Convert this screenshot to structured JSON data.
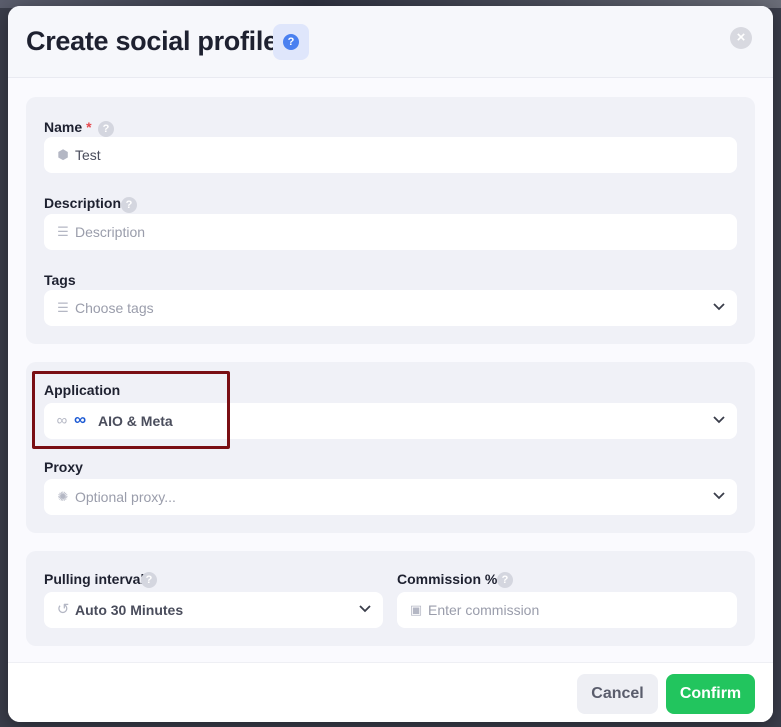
{
  "dialog": {
    "title": "Create social profile",
    "help_icon": "question-icon",
    "close_icon": "close-icon"
  },
  "details": {
    "name": {
      "label": "Name",
      "required_mark": "*",
      "value": "Test",
      "icon": "hexagon-icon"
    },
    "description": {
      "label": "Description",
      "placeholder": "Description",
      "icon": "rows-icon"
    },
    "tags": {
      "label": "Tags",
      "placeholder": "Choose tags",
      "icon": "rows-icon"
    }
  },
  "connection": {
    "application": {
      "label": "Application",
      "value": "AIO & Meta",
      "icons": [
        "infinity-icon",
        "meta-icon"
      ]
    },
    "proxy": {
      "label": "Proxy",
      "placeholder": "Optional proxy...",
      "icon": "globe-icon"
    }
  },
  "settings": {
    "pulling_interval": {
      "label": "Pulling interval",
      "value": "Auto 30 Minutes",
      "icon": "history-icon"
    },
    "commission": {
      "label": "Commission %",
      "placeholder": "Enter commission",
      "icon": "cash-icon"
    }
  },
  "footer": {
    "cancel_label": "Cancel",
    "confirm_label": "Confirm"
  },
  "colors": {
    "accent": "#4a80f0",
    "confirm": "#22c55e",
    "required": "#e5484d",
    "highlight_box": "#7a0f14"
  }
}
